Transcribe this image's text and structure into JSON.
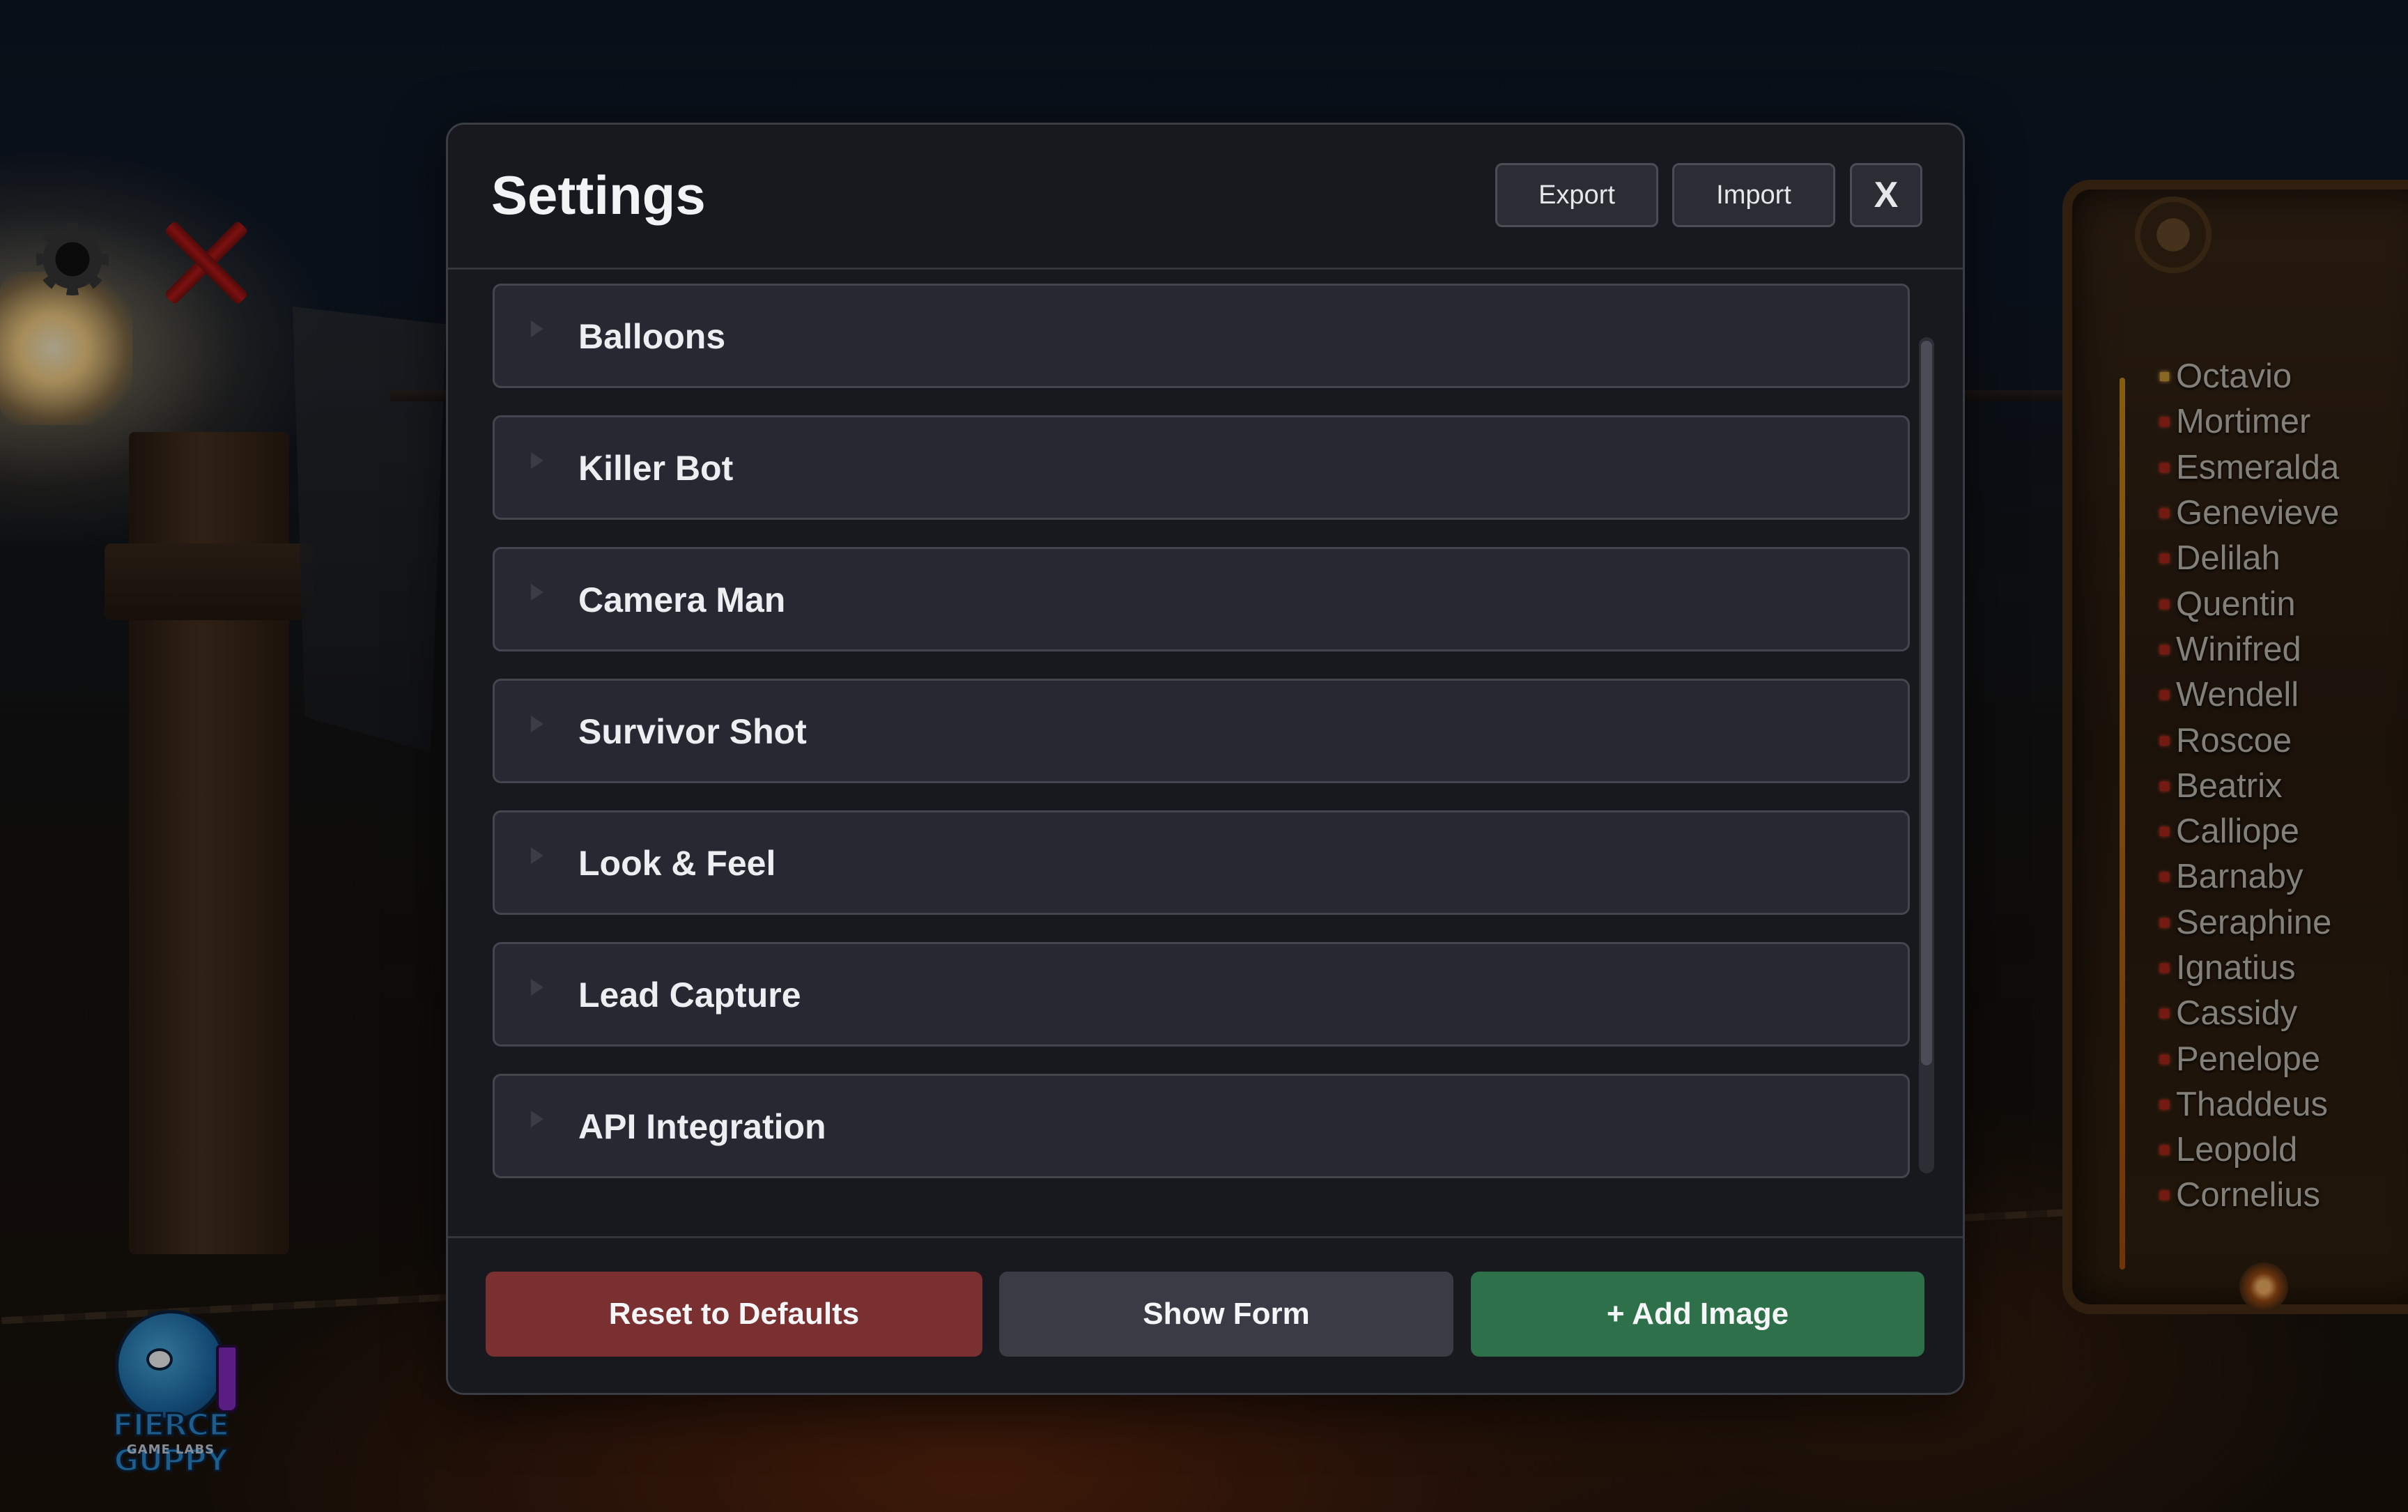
{
  "modal": {
    "title": "Settings",
    "export_label": "Export",
    "import_label": "Import",
    "close_label": "X",
    "sections": [
      {
        "label": "Balloons"
      },
      {
        "label": "Killer Bot"
      },
      {
        "label": "Camera Man"
      },
      {
        "label": "Survivor Shot"
      },
      {
        "label": "Look & Feel"
      },
      {
        "label": "Lead Capture"
      },
      {
        "label": "API Integration"
      }
    ],
    "footer": {
      "reset_label": "Reset to Defaults",
      "show_form_label": "Show Form",
      "add_image_label": "+ Add Image"
    }
  },
  "leaderboard": {
    "players": [
      "Octavio",
      "Mortimer",
      "Esmeralda",
      "Genevieve",
      "Delilah",
      "Quentin",
      "Winifred",
      "Wendell",
      "Roscoe",
      "Beatrix",
      "Calliope",
      "Barnaby",
      "Seraphine",
      "Ignatius",
      "Cassidy",
      "Penelope",
      "Thaddeus",
      "Leopold",
      "Cornelius"
    ]
  },
  "logo": {
    "name": "FIERCE GUPPY",
    "sub": "GAME LABS"
  },
  "colors": {
    "reset": "#7a2f30",
    "show_form": "#393c45",
    "add_image": "#2e7049",
    "modal_bg": "#17191e"
  },
  "icons": {
    "hud_settings": "gear-icon",
    "hud_close": "close-x-icon",
    "section_toggle": "caret-right-icon"
  }
}
